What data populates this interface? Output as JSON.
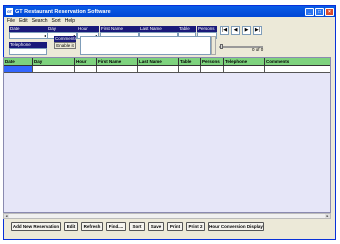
{
  "window": {
    "title": "GT Restaurant Reservation Software",
    "icon_text": "GT"
  },
  "titlebar_buttons": {
    "minimize": "_",
    "maximize": "□",
    "close": "×"
  },
  "menu": [
    "File",
    "Edit",
    "Search",
    "Sort",
    "Help"
  ],
  "form": {
    "date_label": "Date",
    "day_label": "Day",
    "hour_label": "Hour",
    "first_name_label": "First Name",
    "last_name_label": "Last Name",
    "table_label": "Table",
    "persons_label": "Persons",
    "telephone_label": "Telephone",
    "comments_label": "Comments",
    "enable_label": "Enable it",
    "record_count": "0 of 0"
  },
  "nav": {
    "first": "|◀",
    "prev": "◀",
    "next": "▶",
    "last": "▶|"
  },
  "grid": {
    "columns": [
      "Date",
      "Day",
      "Hour",
      "First Name",
      "Last Name",
      "Table",
      "Persons",
      "Telephone",
      "Comments"
    ]
  },
  "buttons": {
    "add_new": "Add New Reservation",
    "edit": "Edit",
    "refresh": "Refresh",
    "find": "Find....",
    "sort": "Sort",
    "save": "Save",
    "print": "Print",
    "print2": "Print 2",
    "hour_conversion": "Hour Conversion Display"
  },
  "colors": {
    "grid_header": "#7ed27e",
    "selection": "#3366ff",
    "label_bg": "#1a1a7a",
    "titlebar": "#0046d5"
  }
}
